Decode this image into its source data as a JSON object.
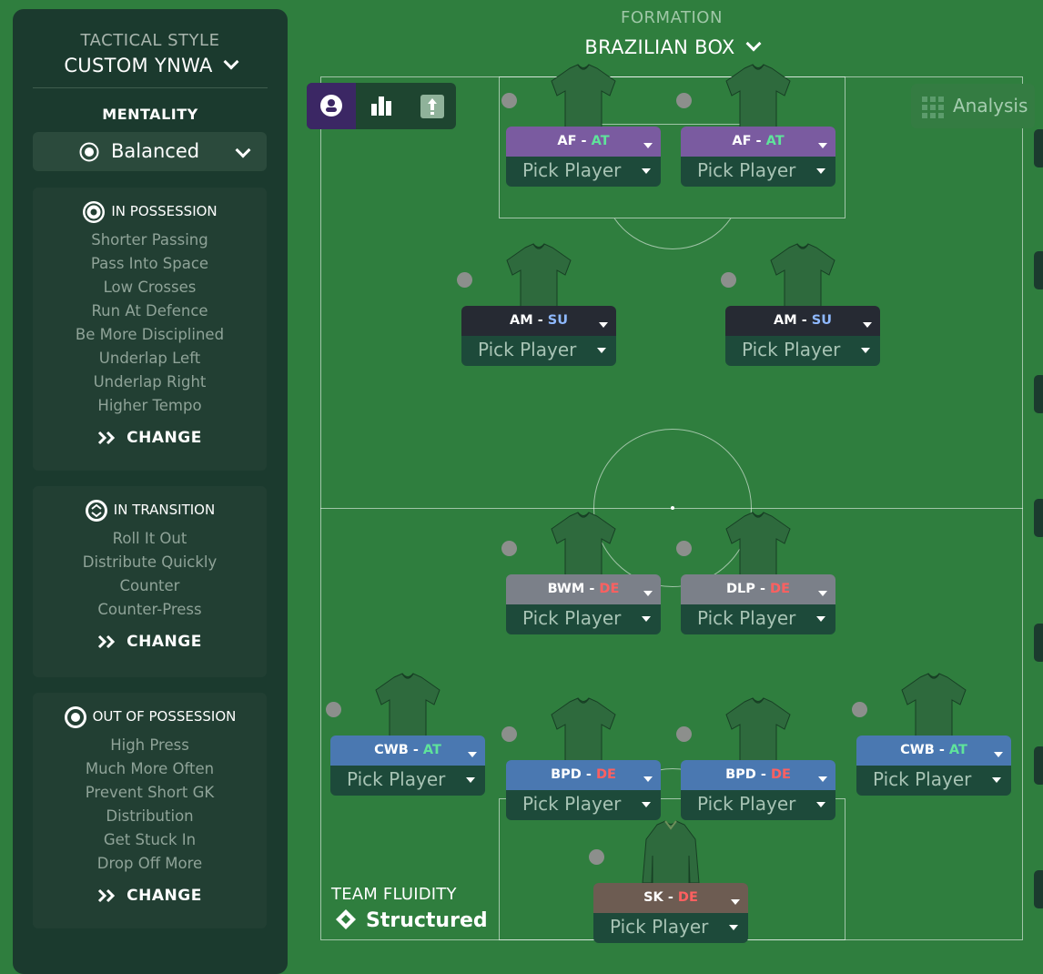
{
  "tactical_style": {
    "label": "TACTICAL STYLE",
    "value": "CUSTOM YNWA"
  },
  "mentality": {
    "label": "MENTALITY",
    "value": "Balanced"
  },
  "in_possession": {
    "title": "IN POSSESSION",
    "items": [
      "Shorter Passing",
      "Pass Into Space",
      "Low Crosses",
      "Run At Defence",
      "Be More Disciplined",
      "Underlap Left",
      "Underlap Right",
      "Higher Tempo"
    ],
    "change_label": "CHANGE"
  },
  "in_transition": {
    "title": "IN TRANSITION",
    "items": [
      "Roll It Out",
      "Distribute Quickly",
      "Counter",
      "Counter-Press"
    ],
    "change_label": "CHANGE"
  },
  "out_of_possession": {
    "title": "OUT OF POSSESSION",
    "items": [
      "High Press",
      "Much More Often",
      "Prevent Short GK",
      "Distribution",
      "Get Stuck In",
      "Drop Off More"
    ],
    "change_label": "CHANGE"
  },
  "formation": {
    "label": "FORMATION",
    "value": "BRAZILIAN BOX"
  },
  "analysis": {
    "label": "Analysis"
  },
  "team_fluidity": {
    "label": "TEAM FLUIDITY",
    "value": "Structured"
  },
  "positions": [
    {
      "role": "AF",
      "duty": "AT",
      "player": "Pick Player"
    },
    {
      "role": "AF",
      "duty": "AT",
      "player": "Pick Player"
    },
    {
      "role": "AM",
      "duty": "SU",
      "player": "Pick Player"
    },
    {
      "role": "AM",
      "duty": "SU",
      "player": "Pick Player"
    },
    {
      "role": "BWM",
      "duty": "DE",
      "player": "Pick Player"
    },
    {
      "role": "DLP",
      "duty": "DE",
      "player": "Pick Player"
    },
    {
      "role": "CWB",
      "duty": "AT",
      "player": "Pick Player"
    },
    {
      "role": "BPD",
      "duty": "DE",
      "player": "Pick Player"
    },
    {
      "role": "BPD",
      "duty": "DE",
      "player": "Pick Player"
    },
    {
      "role": "CWB",
      "duty": "AT",
      "player": "Pick Player"
    },
    {
      "role": "SK",
      "duty": "DE",
      "player": "Pick Player"
    }
  ],
  "colors": {
    "pitch": "#2f7e3e",
    "panel": "#1b3a2e",
    "attack": "#5fe39b",
    "support": "#8fb9ff",
    "defend": "#ff6060"
  }
}
